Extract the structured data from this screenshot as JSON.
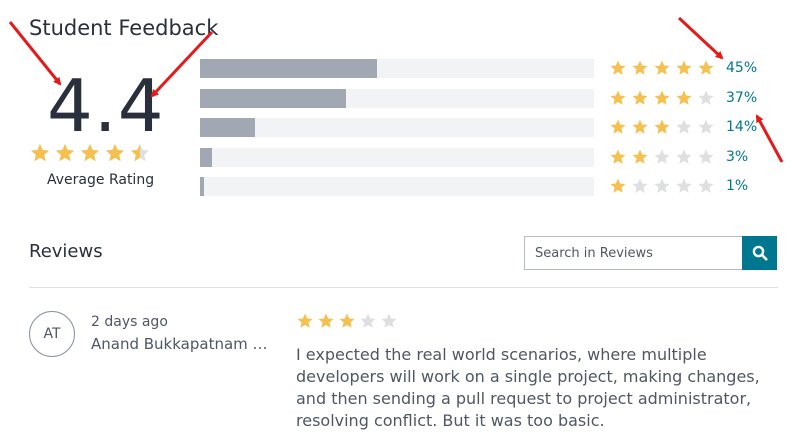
{
  "feedback": {
    "title": "Student Feedback",
    "average": "4.4",
    "average_stars": 4.4,
    "average_label": "Average Rating",
    "breakdown": [
      {
        "stars": 5,
        "percent_label": "45%",
        "fraction": 0.45
      },
      {
        "stars": 4,
        "percent_label": "37%",
        "fraction": 0.37
      },
      {
        "stars": 3,
        "percent_label": "14%",
        "fraction": 0.14
      },
      {
        "stars": 2,
        "percent_label": "3%",
        "fraction": 0.03
      },
      {
        "stars": 1,
        "percent_label": "1%",
        "fraction": 0.01
      }
    ]
  },
  "reviews": {
    "title": "Reviews",
    "search_placeholder": "Search in Reviews",
    "search_icon": "search-icon",
    "items": [
      {
        "initials": "AT",
        "time": "2 days ago",
        "name": "Anand Bukkapatnam Tir...",
        "stars": 3,
        "text": "I expected the real world scenarios, where multiple developers will work on a single project, making changes, and then sending a pull request to project administrator, resolving conflict. But it was too basic."
      }
    ]
  },
  "colors": {
    "star_filled": "#f4c150",
    "star_empty": "#dedfe0",
    "bar_fill": "#a1a7b3",
    "bar_track": "#f2f3f5",
    "accent": "#007791",
    "annotation_arrow": "#e51a1a"
  }
}
